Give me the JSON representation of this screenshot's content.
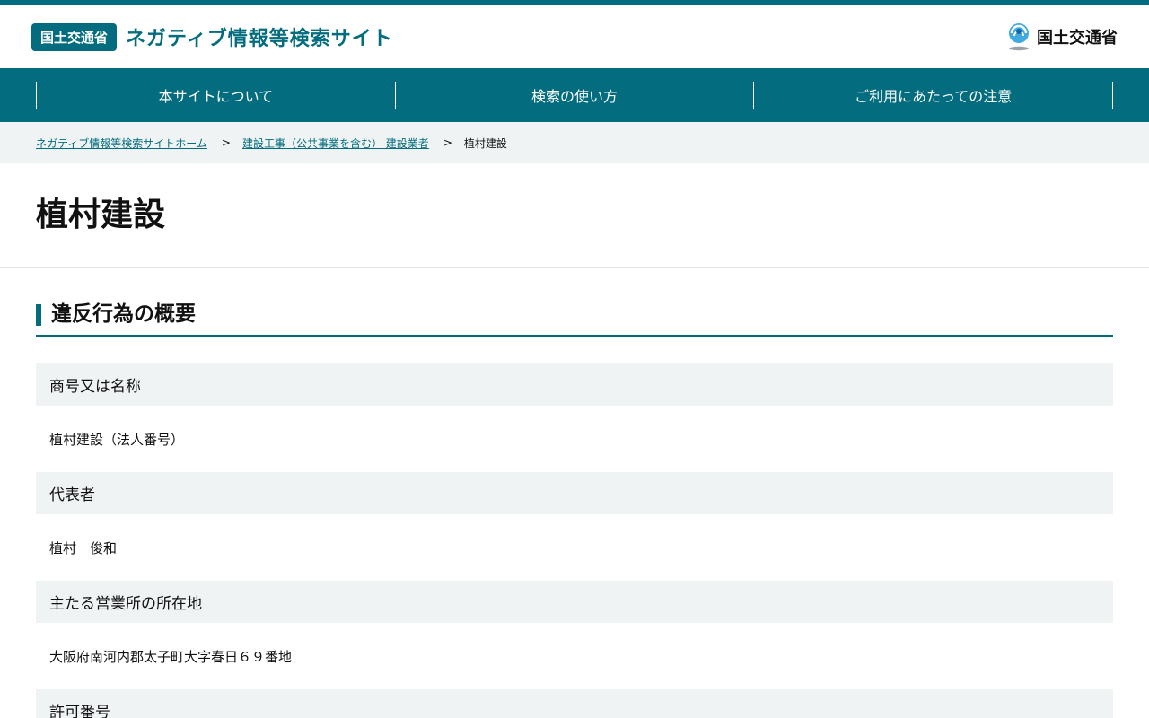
{
  "header": {
    "badge": "国土交通省",
    "site_title": "ネガティブ情報等検索サイト",
    "ministry_name": "国土交通省",
    "ministry_logo_icon": "mlit-logo-icon"
  },
  "nav": {
    "items": [
      {
        "label": "本サイトについて"
      },
      {
        "label": "検索の使い方"
      },
      {
        "label": "ご利用にあたっての注意"
      }
    ]
  },
  "breadcrumb": {
    "home": "ネガティブ情報等検索サイトホーム",
    "category": "建設工事（公共事業を含む） 建設業者",
    "separator": ">",
    "current": "植村建設"
  },
  "page": {
    "title": "植村建設"
  },
  "section": {
    "heading": "違反行為の概要",
    "fields": [
      {
        "label": "商号又は名称",
        "value": "植村建設（法人番号）"
      },
      {
        "label": "代表者",
        "value": "植村　俊和"
      },
      {
        "label": "主たる営業所の所在地",
        "value": "大阪府南河内郡太子町大字春日６９番地"
      },
      {
        "label": "許可番号",
        "value": ""
      }
    ]
  },
  "colors": {
    "brand": "#036c7e",
    "light_bg": "#eff3f4"
  }
}
